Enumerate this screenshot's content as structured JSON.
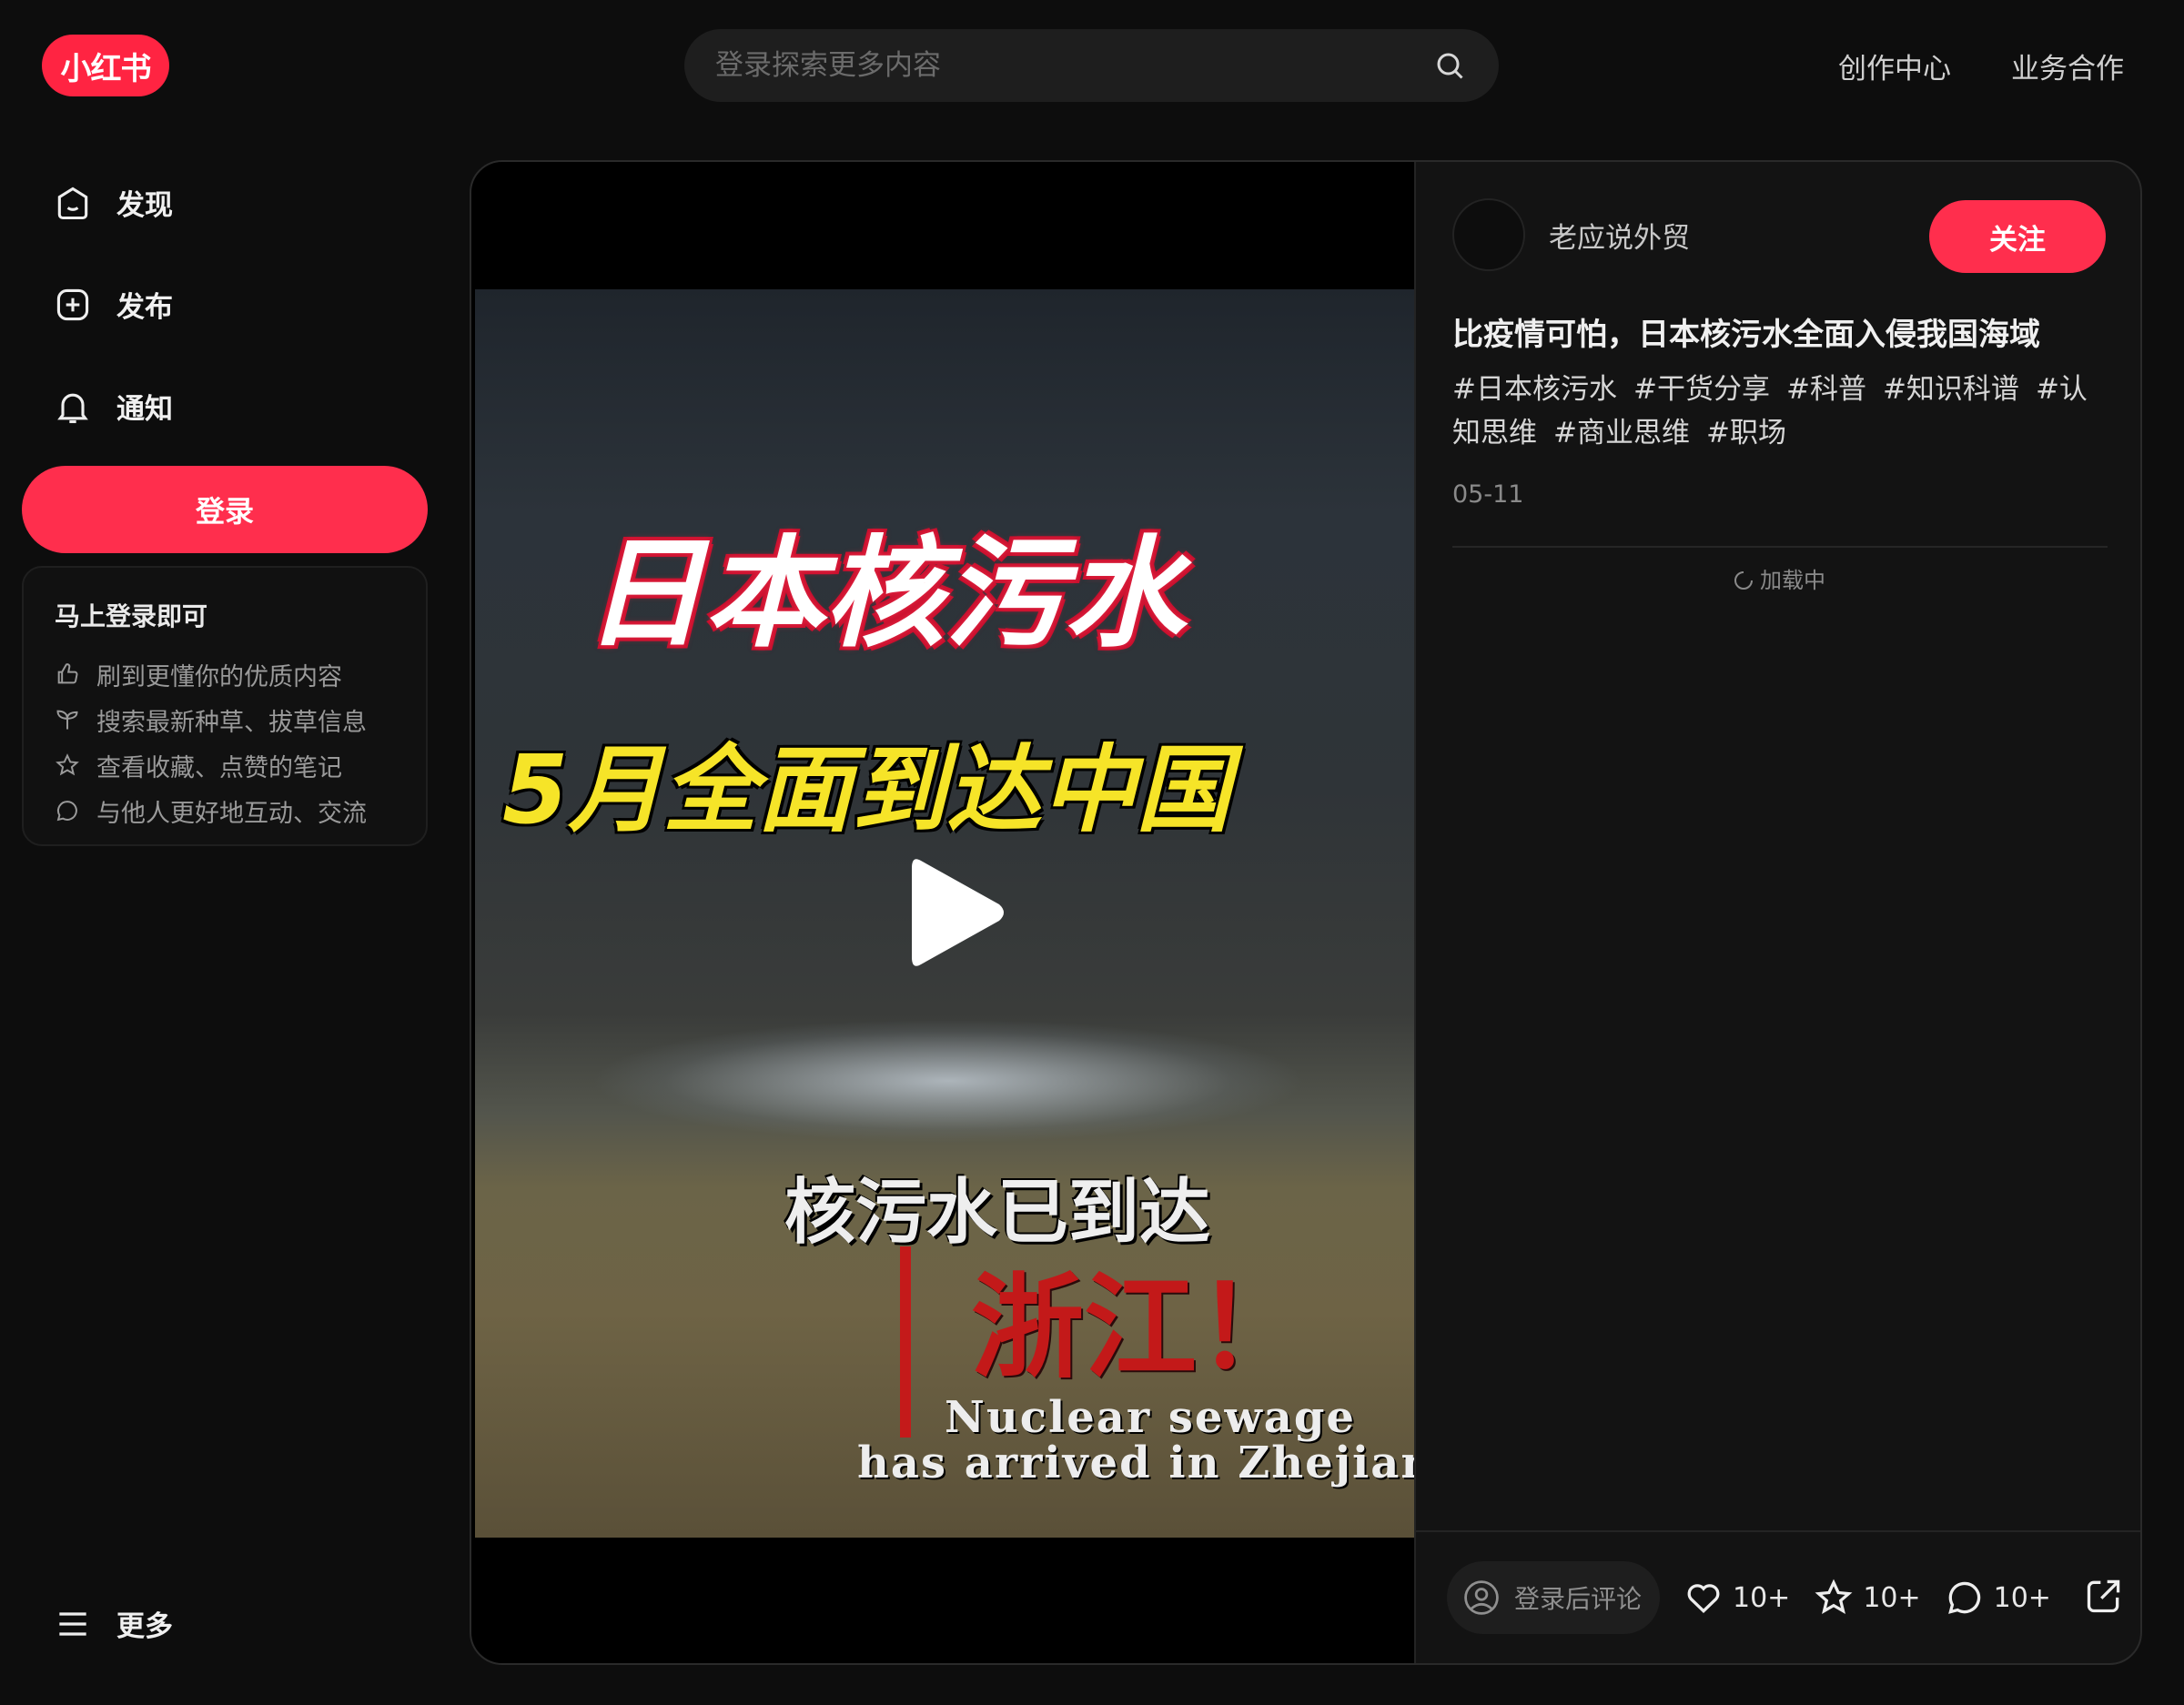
{
  "header": {
    "logo_text": "小红书",
    "search_placeholder": "登录探索更多内容",
    "links": [
      "创作中心",
      "业务合作"
    ]
  },
  "sidebar": {
    "items": [
      {
        "label": "发现",
        "icon": "discover-icon"
      },
      {
        "label": "发布",
        "icon": "publish-icon"
      },
      {
        "label": "通知",
        "icon": "bell-icon"
      }
    ],
    "login_label": "登录",
    "login_card": {
      "title": "马上登录即可",
      "perks": [
        {
          "text": "刷到更懂你的优质内容",
          "icon": "thumb-up-icon"
        },
        {
          "text": "搜索最新种草、拔草信息",
          "icon": "sprout-icon"
        },
        {
          "text": "查看收藏、点赞的笔记",
          "icon": "star-icon"
        },
        {
          "text": "与他人更好地互动、交流",
          "icon": "chat-bubble-icon"
        }
      ]
    },
    "more_label": "更多"
  },
  "video": {
    "line1": "日本核污水",
    "line2": "5月全面到达中国",
    "line3": "核污水已到达",
    "line4": "浙江！",
    "line5a": "Nuclear sewage",
    "line5b": "has arrived in Zhejiang"
  },
  "note": {
    "author": "老应说外贸",
    "follow_label": "关注",
    "title": "比疫情可怕，日本核污水全面入侵我国海域",
    "tags": [
      "#日本核污水",
      "#干货分享",
      "#科普",
      "#知识科谱",
      "#认知思维",
      "#商业思维",
      "#职场"
    ],
    "date": "05-11",
    "loading_text": "加载中",
    "comment_placeholder": "登录后评论",
    "likes": "10+",
    "collects": "10+",
    "comments": "10+"
  },
  "colors": {
    "accent": "#ff2e4d",
    "background": "#0d0d0d",
    "panel": "#131313"
  }
}
